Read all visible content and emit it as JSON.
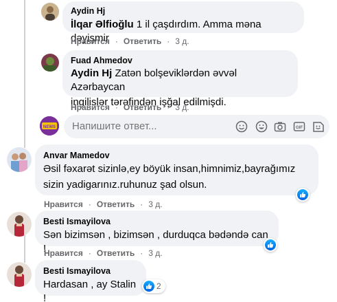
{
  "comments": [
    {
      "author": "Aydin Hj",
      "mention": "İlqar Əlfioğlu",
      "text": " 1 il çaşdırdım. Amma məna dəyişmir",
      "like_label": "Нравится",
      "reply_label": "Ответить",
      "time": "3 д."
    },
    {
      "author": "Fuad Ahmedov",
      "mention": "Aydin Hj",
      "text_line1": " Zatən bolşeviklərdən əvvəl Azərbaycan",
      "text_line2": "ingilislər tərəfindən işğal edilmişdi.",
      "like_label": "Нравится",
      "reply_label": "Ответить",
      "time": "3 д."
    },
    {
      "author": "Anvar Mamedov",
      "text_line1": "Əsil fəxarət sizinlə,ey böyük insan,himnimiz,bayrağımız",
      "text_line2": "sizin yadigarınız.ruhunuz şad olsun.",
      "like_label": "Нравится",
      "reply_label": "Ответить",
      "time": "3 д."
    },
    {
      "author": "Besti Ismayilova",
      "text": "Sən bizimsən , bizimsən , durduqca bədəndə can !",
      "like_label": "Нравится",
      "reply_label": "Ответить",
      "time": "3 д."
    },
    {
      "author": "Besti Ismayilova",
      "text": "Hardasan , ay Stalin !",
      "reaction_count": "2"
    }
  ],
  "reply": {
    "placeholder": "Напишите ответ..."
  },
  "colors": {
    "bubble": "#f0f2f5",
    "secondary_text": "#65676b",
    "like_blue": "#1877f2"
  },
  "icons": [
    "emoji-icon",
    "sticker-smile-icon",
    "camera-icon",
    "gif-icon",
    "sticker-icon",
    "like-reaction-icon"
  ]
}
